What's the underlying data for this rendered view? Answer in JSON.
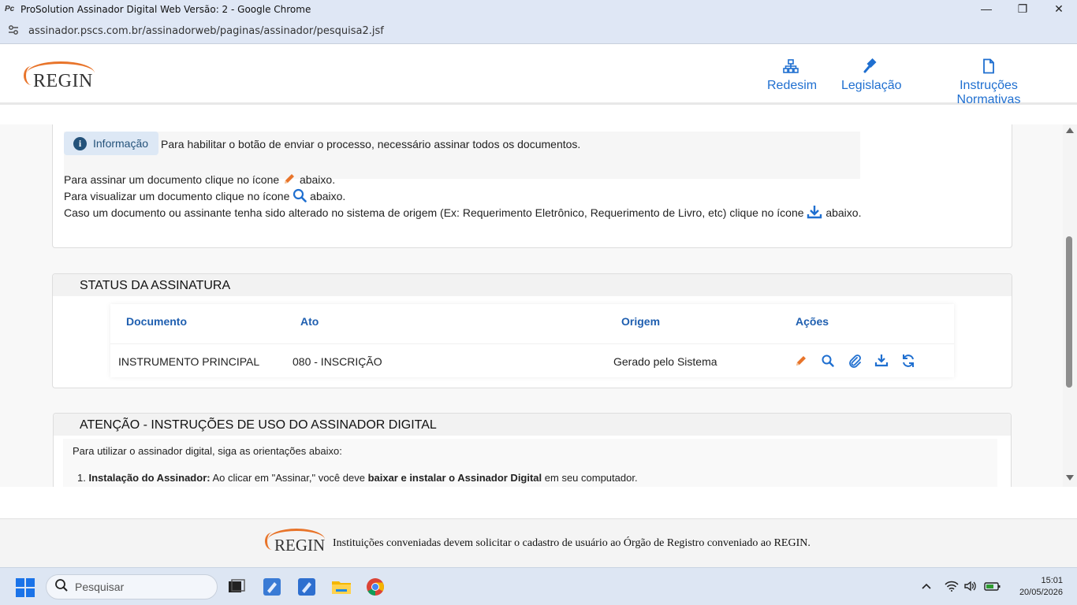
{
  "browser": {
    "window_title": "ProSolution Assinador Digital Web Versão: 2 - Google Chrome",
    "url": "assinador.pscs.com.br/assinadorweb/paginas/assinador/pesquisa2.jsf",
    "minimize": "—",
    "maximize": "❐",
    "close": "✕"
  },
  "header": {
    "logo_text": "REGIN",
    "nav": [
      {
        "label": "Redesim",
        "icon": "sitemap-icon"
      },
      {
        "label": "Legislação",
        "icon": "gavel-icon"
      },
      {
        "label": "Instruções Normativas",
        "icon": "document-icon"
      }
    ]
  },
  "info": {
    "badge": "Informação",
    "message": "Para habilitar o botão de enviar o processo, necessário assinar todos os documentos.",
    "line1_pre": "Para assinar um documento clique no ícone",
    "line1_post": "abaixo.",
    "line2_pre": "Para visualizar um documento clique no ícone",
    "line2_post": "abaixo.",
    "line3_pre": "Caso um documento ou assinante tenha sido alterado no sistema de origem (Ex: Requerimento Eletrônico, Requerimento de Livro, etc) clique no ícone",
    "line3_post": "abaixo."
  },
  "status": {
    "title": "STATUS DA ASSINATURA",
    "columns": [
      "Documento",
      "Ato",
      "Origem",
      "Ações"
    ],
    "rows": [
      {
        "documento": "INSTRUMENTO PRINCIPAL",
        "ato": "080 - INSCRIÇÃO",
        "origem": "Gerado pelo Sistema"
      }
    ]
  },
  "instructions": {
    "title": "ATENÇÃO - INSTRUÇÕES DE USO DO ASSINADOR DIGITAL",
    "intro": "Para utilizar o assinador digital, siga as orientações abaixo:",
    "item1_num": "1.",
    "item1_bold": "Instalação do Assinador:",
    "item1_text": " Ao clicar em \"Assinar,\" você deve ",
    "item1_bold2": "baixar e instalar o Assinador Digital",
    "item1_end": " em seu computador."
  },
  "footer": {
    "logo_text": "REGIN",
    "text": "Instituições conveniadas devem solicitar o cadastro de usuário ao Órgão de Registro conveniado ao REGIN."
  },
  "taskbar": {
    "search_placeholder": "Pesquisar",
    "time": "15:01",
    "date": "20/05/2026"
  },
  "colors": {
    "accent_blue": "#1f6fd0",
    "orange": "#e8742a",
    "header_blue": "#1f5fb0"
  }
}
